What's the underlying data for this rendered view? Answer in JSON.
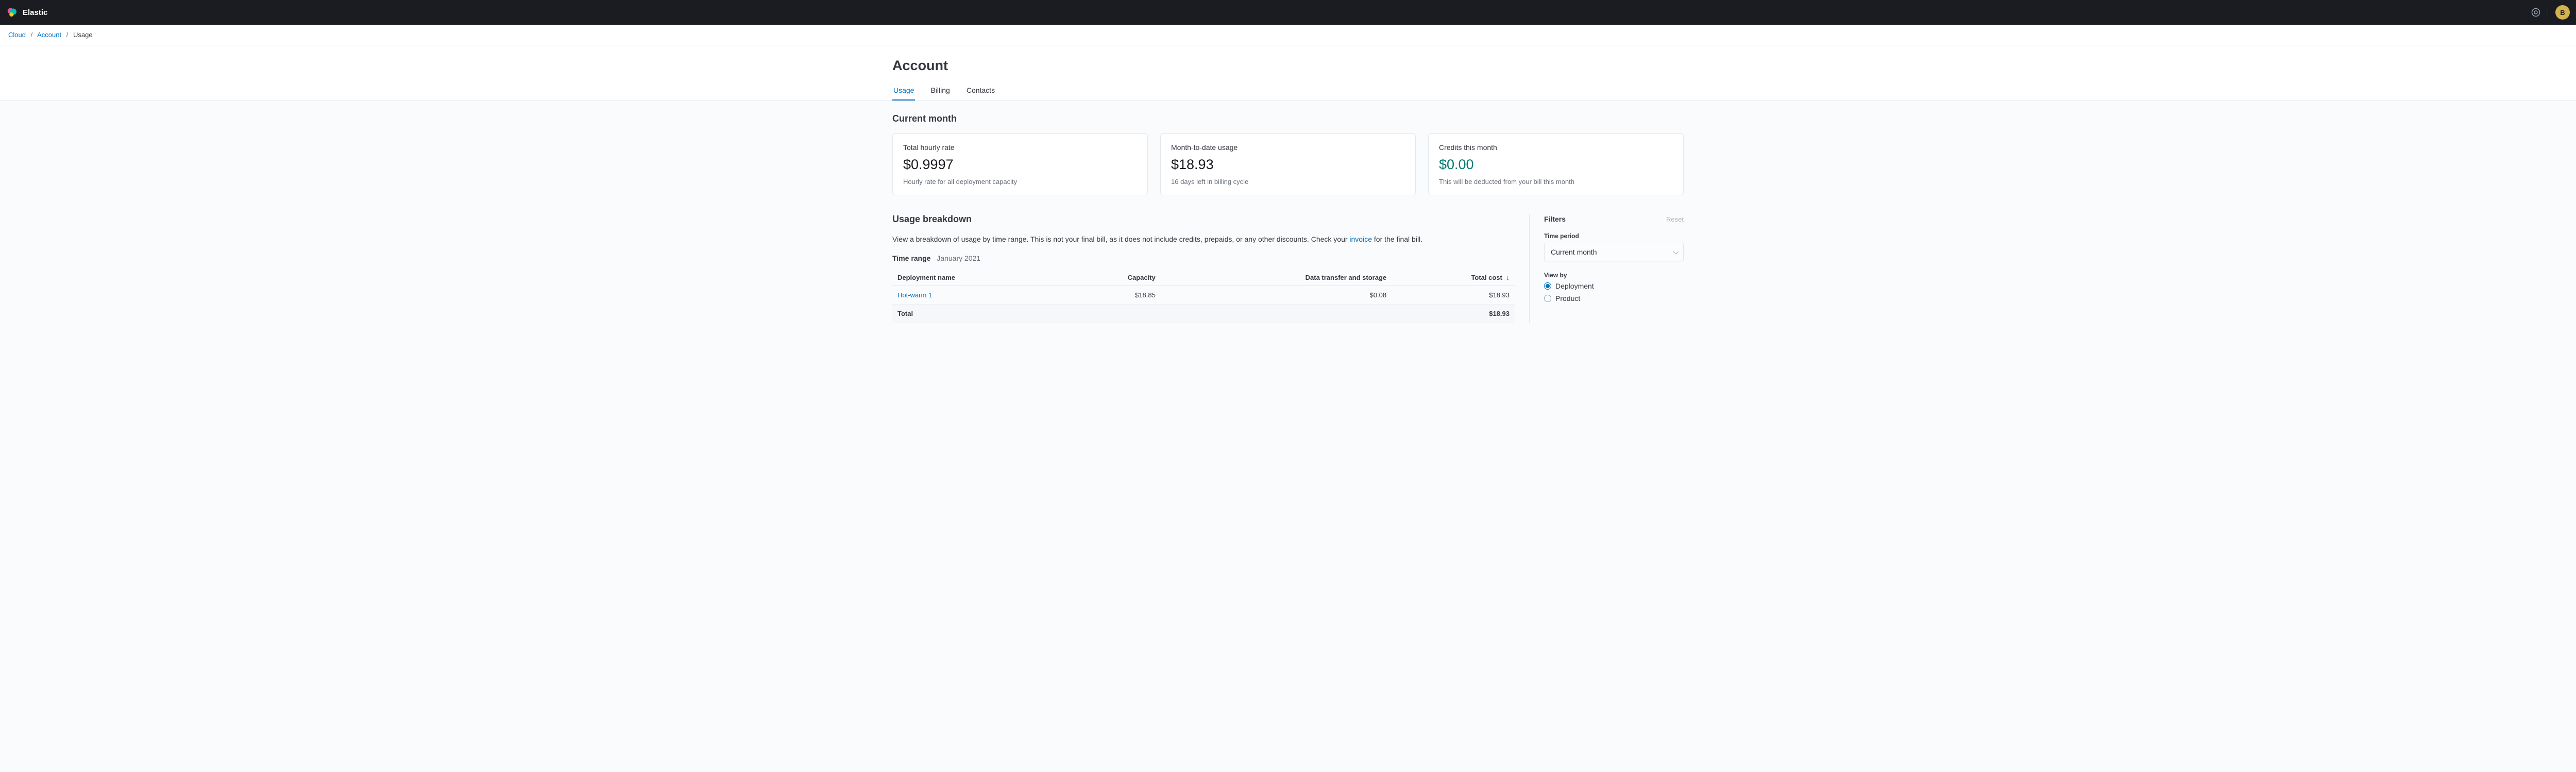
{
  "header": {
    "brand": "Elastic",
    "avatar_initial": "B"
  },
  "breadcrumb": {
    "items": [
      "Cloud",
      "Account"
    ],
    "current": "Usage"
  },
  "page": {
    "title": "Account"
  },
  "tabs": {
    "items": [
      {
        "label": "Usage",
        "active": true
      },
      {
        "label": "Billing",
        "active": false
      },
      {
        "label": "Contacts",
        "active": false
      }
    ]
  },
  "current_month": {
    "heading": "Current month",
    "cards": [
      {
        "label": "Total hourly rate",
        "value": "$0.9997",
        "sub": "Hourly rate for all deployment capacity"
      },
      {
        "label": "Month-to-date usage",
        "value": "$18.93",
        "sub": "16 days left in billing cycle"
      },
      {
        "label": "Credits this month",
        "value": "$0.00",
        "sub": "This will be deducted from your bill this month",
        "credit": true
      }
    ]
  },
  "breakdown": {
    "heading": "Usage breakdown",
    "description_pre": "View a breakdown of usage by time range. This is not your final bill, as it does not include credits, prepaids, or any other discounts. Check your ",
    "description_link": "invoice",
    "description_post": " for the final bill.",
    "time_range_label": "Time range",
    "time_range_value": "January 2021",
    "table": {
      "headers": [
        "Deployment name",
        "Capacity",
        "Data transfer and storage",
        "Total cost"
      ],
      "rows": [
        {
          "name": "Hot-warm 1",
          "capacity": "$18.85",
          "dts": "$0.08",
          "total": "$18.93"
        }
      ],
      "total_row": {
        "label": "Total",
        "value": "$18.93"
      }
    }
  },
  "filters": {
    "title": "Filters",
    "reset": "Reset",
    "time_period_label": "Time period",
    "time_period_value": "Current month",
    "view_by_label": "View by",
    "view_by_options": [
      {
        "label": "Deployment",
        "checked": true
      },
      {
        "label": "Product",
        "checked": false
      }
    ]
  }
}
